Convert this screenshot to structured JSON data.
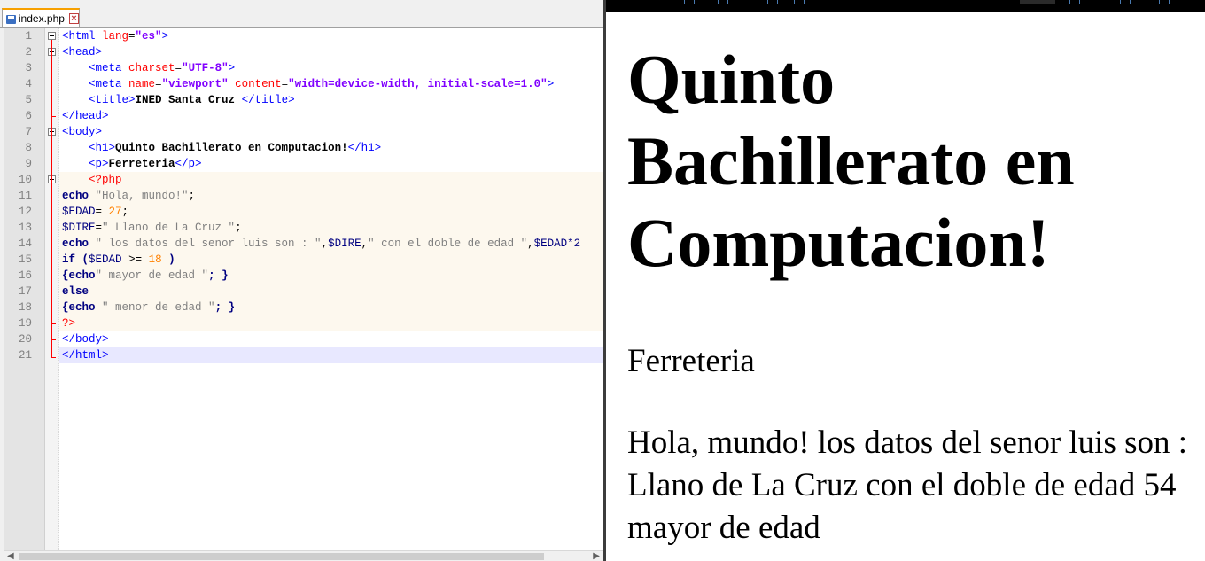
{
  "editor": {
    "tab_label": "index.php",
    "lines": [
      {
        "n": "1"
      },
      {
        "n": "2"
      },
      {
        "n": "3"
      },
      {
        "n": "4"
      },
      {
        "n": "5"
      },
      {
        "n": "6"
      },
      {
        "n": "7"
      },
      {
        "n": "8"
      },
      {
        "n": "9"
      },
      {
        "n": "10"
      },
      {
        "n": "11"
      },
      {
        "n": "12"
      },
      {
        "n": "13"
      },
      {
        "n": "14"
      },
      {
        "n": "15"
      },
      {
        "n": "16"
      },
      {
        "n": "17"
      },
      {
        "n": "18"
      },
      {
        "n": "19"
      },
      {
        "n": "20"
      },
      {
        "n": "21"
      }
    ],
    "code": {
      "l1": {
        "open": "<html ",
        "attr": "lang",
        "eq": "=",
        "val": "\"es\"",
        "close": ">"
      },
      "l2": {
        "tag": "<head>"
      },
      "l3": {
        "indent": "    ",
        "open": "<meta ",
        "attr": "charset",
        "eq": "=",
        "val": "\"UTF-8\"",
        "close": ">"
      },
      "l4": {
        "indent": "    ",
        "open": "<meta ",
        "attr1": "name",
        "eq1": "=",
        "val1": "\"viewport\"",
        "sp": " ",
        "attr2": "content",
        "eq2": "=",
        "val2": "\"width=device-width, initial-scale=1.0\"",
        "close": ">"
      },
      "l5": {
        "indent": "    ",
        "open": "<title>",
        "text": "INED Santa Cruz ",
        "close": "</title>"
      },
      "l6": {
        "tag": "</head>"
      },
      "l7": {
        "tag": "<body>"
      },
      "l8": {
        "indent": "    ",
        "open": "<h1>",
        "text": "Quinto Bachillerato en Computacion!",
        "close": "</h1>"
      },
      "l9": {
        "indent": "    ",
        "open": "<p>",
        "text": "Ferreteria",
        "close": "</p>"
      },
      "l10": {
        "indent": "    ",
        "php": "<?php"
      },
      "l11": {
        "kw": "echo",
        "str": " \"Hola, mundo!\"",
        "end": ";"
      },
      "l12": {
        "var": "$EDAD",
        "op": "=",
        "num": " 27",
        "end": ";"
      },
      "l13": {
        "var": "$DIRE",
        "op": "=",
        "str": "\" Llano de La Cruz \"",
        "end": ";"
      },
      "l14": {
        "kw": "echo",
        "str1": " \" los datos del senor luis son : \"",
        "c1": ",",
        "var1": "$DIRE",
        "c2": ",",
        "str2": "\" con el doble de edad \"",
        "c3": ",",
        "var2": "$EDAD*2"
      },
      "l15": {
        "kw": "if",
        "sp": " ",
        "p1": "(",
        "var": "$EDAD",
        "op": " >= ",
        "num": "18",
        "p2": " )"
      },
      "l16": {
        "b1": "{",
        "kw": "echo",
        "str": "\" mayor de edad \"",
        "end": "; }"
      },
      "l17": {
        "kw": "else"
      },
      "l18": {
        "b1": "{",
        "kw": "echo",
        "str": " \" menor de edad \"",
        "end": "; }"
      },
      "l19": {
        "php": "?>"
      },
      "l20": {
        "tag": "</body>"
      },
      "l21": {
        "tag": "</html>"
      }
    }
  },
  "browser": {
    "heading": "Quinto Bachillerato en Computacion!",
    "paragraph": "Ferreteria",
    "output": "Hola, mundo! los datos del senor luis son : Llano de La Cruz con el doble de edad 54 mayor de edad"
  }
}
